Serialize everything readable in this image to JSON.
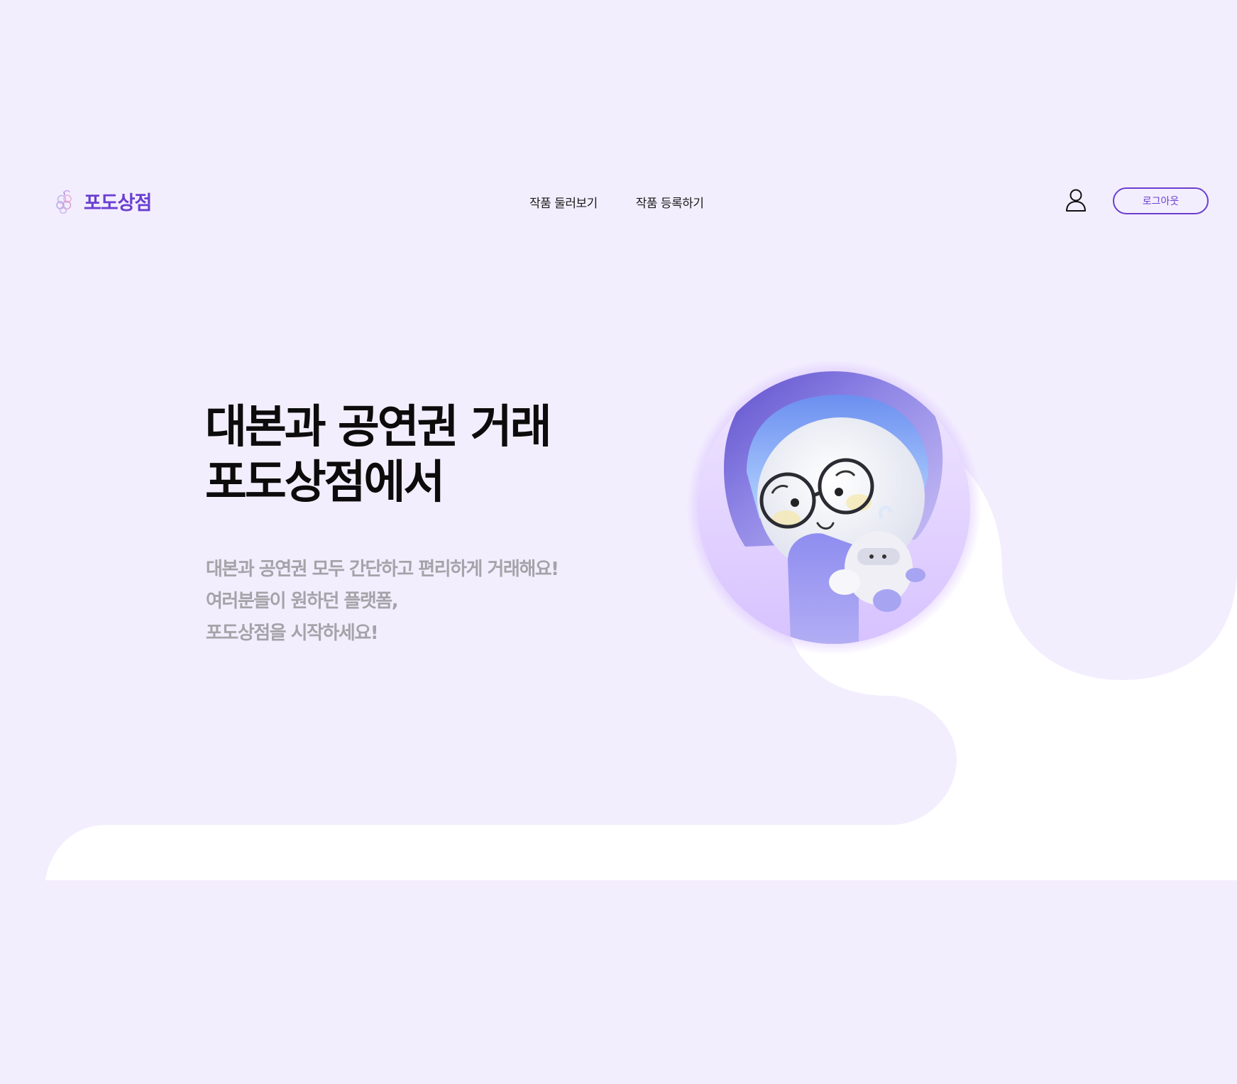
{
  "header": {
    "logo_text": "포도상점",
    "nav": [
      {
        "label": "작품 둘러보기"
      },
      {
        "label": "작품 등록하기"
      }
    ],
    "logout_label": "로그아웃",
    "icons": {
      "logo": "grape-icon",
      "user": "user-icon"
    }
  },
  "hero": {
    "title_lines": [
      "대본과 공연권 거래",
      "포도상점에서"
    ],
    "subtitle_lines": [
      "대본과 공연권 모두 간단하고 편리하게 거래해요!",
      "여러분들이 원하던 플랫폼,",
      "포도상점을 시작하세요!"
    ]
  },
  "colors": {
    "background": "#f3eefe",
    "accent": "#6a3fd0",
    "title": "#0c0c0c",
    "subtitle": "#a5a3a8",
    "wave": "#ffffff"
  }
}
